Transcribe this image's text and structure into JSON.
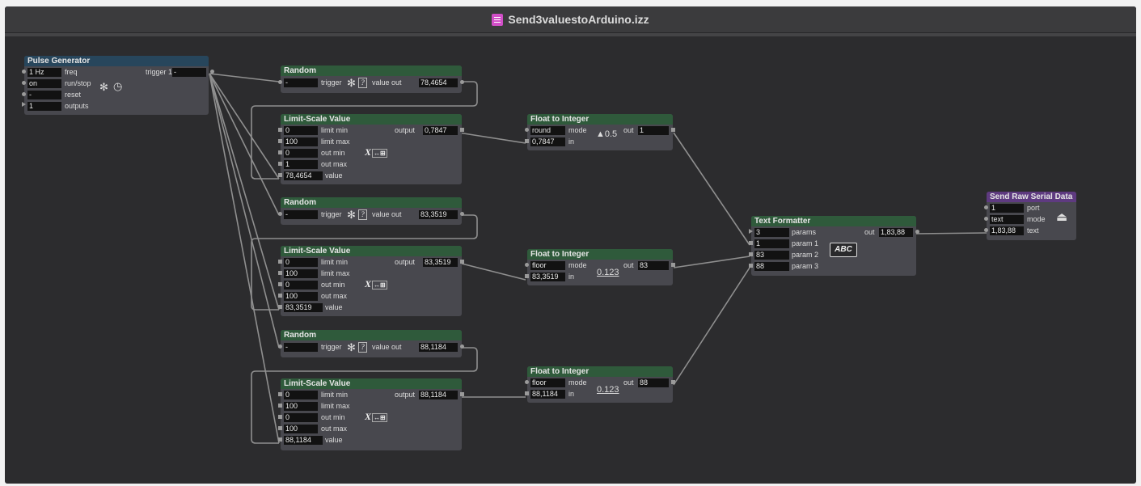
{
  "window": {
    "title": "Send3valuestoArduino.izz"
  },
  "pulse": {
    "title": "Pulse Generator",
    "freq": "1 Hz",
    "freq_label": "freq",
    "run": "on",
    "run_label": "run/stop",
    "reset": "-",
    "reset_label": "reset",
    "outputs": "1",
    "outputs_label": "outputs",
    "trigger_label": "trigger 1",
    "trigger": "-"
  },
  "random1": {
    "title": "Random",
    "trigger": "-",
    "trigger_label": "trigger",
    "out_label": "value out",
    "out": "78,4654"
  },
  "random2": {
    "title": "Random",
    "trigger": "-",
    "trigger_label": "trigger",
    "out_label": "value out",
    "out": "83,3519"
  },
  "random3": {
    "title": "Random",
    "trigger": "-",
    "trigger_label": "trigger",
    "out_label": "value out",
    "out": "88,1184"
  },
  "limit1": {
    "title": "Limit-Scale Value",
    "limit_min": "0",
    "limit_max": "100",
    "out_min": "0",
    "out_max": "1",
    "value": "78,4654",
    "output": "0,7847",
    "output_label": "output",
    "l_limit_min": "limit min",
    "l_limit_max": "limit max",
    "l_out_min": "out min",
    "l_out_max": "out max",
    "l_value": "value"
  },
  "limit2": {
    "title": "Limit-Scale Value",
    "limit_min": "0",
    "limit_max": "100",
    "out_min": "0",
    "out_max": "100",
    "value": "83,3519",
    "output": "83,3519",
    "output_label": "output",
    "l_limit_min": "limit min",
    "l_limit_max": "limit max",
    "l_out_min": "out min",
    "l_out_max": "out max",
    "l_value": "value"
  },
  "limit3": {
    "title": "Limit-Scale Value",
    "limit_min": "0",
    "limit_max": "100",
    "out_min": "0",
    "out_max": "100",
    "value": "88,1184",
    "output": "88,1184",
    "output_label": "output",
    "l_limit_min": "limit min",
    "l_limit_max": "limit max",
    "l_out_min": "out min",
    "l_out_max": "out max",
    "l_value": "value"
  },
  "f2i1": {
    "title": "Float to Integer",
    "mode": "round",
    "mode_label": "mode",
    "in": "0,7847",
    "in_label": "in",
    "out_label": "out",
    "out": "1",
    "icon_text": "▲0.5"
  },
  "f2i2": {
    "title": "Float to Integer",
    "mode": "floor",
    "mode_label": "mode",
    "in": "83,3519",
    "in_label": "in",
    "out_label": "out",
    "out": "83",
    "icon_text": "0.123"
  },
  "f2i3": {
    "title": "Float to Integer",
    "mode": "floor",
    "mode_label": "mode",
    "in": "88,1184",
    "in_label": "in",
    "out_label": "out",
    "out": "88",
    "icon_text": "0.123"
  },
  "textfmt": {
    "title": "Text Formatter",
    "params": "3",
    "params_label": "params",
    "p1": "1",
    "p1_label": "param 1",
    "p2": "83",
    "p2_label": "param 2",
    "p3": "88",
    "p3_label": "param 3",
    "out_label": "out",
    "out": "1,83,88",
    "icon_text": "ABC"
  },
  "serial": {
    "title": "Send Raw Serial Data",
    "port": "1",
    "port_label": "port",
    "mode": "text",
    "mode_label": "mode",
    "text": "1,83,88",
    "text_label": "text"
  },
  "icons": {
    "x_button": "X",
    "x_arrow": "↔⊞",
    "question": "?"
  },
  "colors": {
    "wire": "#8f8f8f",
    "header_green": "#2f5a3b",
    "header_blue": "#27465c",
    "header_purple": "#5e3a80",
    "field_bg": "#121212"
  }
}
